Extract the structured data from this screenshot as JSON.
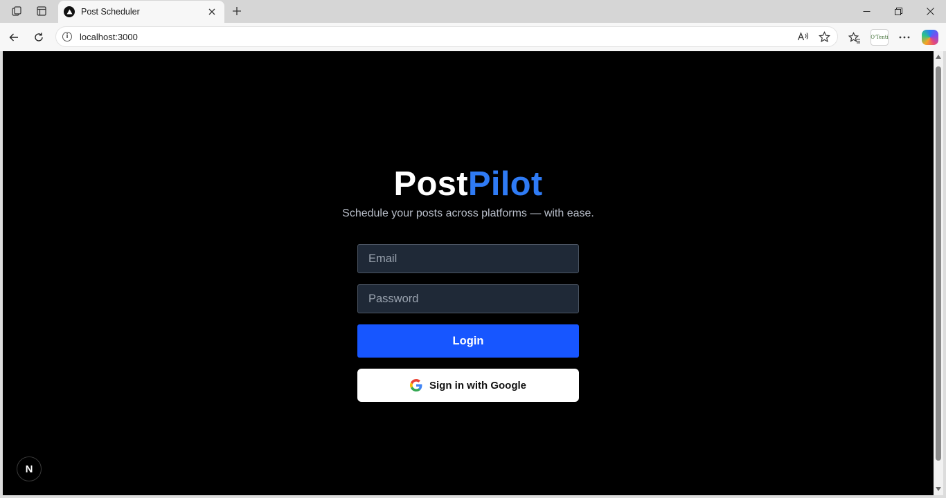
{
  "browser": {
    "tab": {
      "title": "Post Scheduler"
    },
    "address": {
      "url": "localhost:3000"
    },
    "profile_label": "O'Tenti",
    "icons": [
      "workspaces-icon",
      "vertical-tabs-icon",
      "tab-favicon-icon",
      "close-icon",
      "new-tab-icon",
      "minimize-icon",
      "restore-icon",
      "window-close-icon",
      "back-icon",
      "refresh-icon",
      "info-icon",
      "read-aloud-icon",
      "favorite-star-icon",
      "favorites-icon",
      "more-icon",
      "copilot-icon"
    ]
  },
  "page": {
    "brand": {
      "part1": "Post",
      "part2": "Pilot"
    },
    "tagline": "Schedule your posts across platforms — with ease.",
    "email": {
      "placeholder": "Email",
      "value": ""
    },
    "password": {
      "placeholder": "Password",
      "value": ""
    },
    "login_label": "Login",
    "google_label": "Sign in with Google",
    "dev_badge": "N",
    "colors": {
      "background": "#000000",
      "accent": "#2f7bf5",
      "login_button": "#1756ff",
      "input_bg": "#1f2937"
    }
  }
}
